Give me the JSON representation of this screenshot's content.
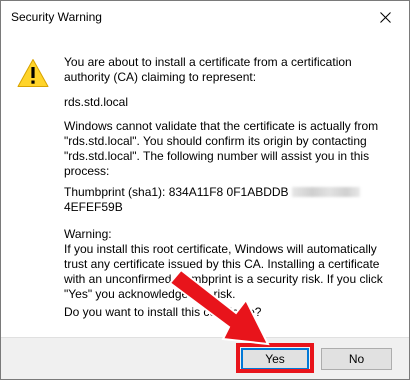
{
  "window": {
    "title": "Security Warning",
    "close_icon": "close-icon"
  },
  "message": {
    "intro": "You are about to install a certificate from a certification authority (CA) claiming to represent:",
    "host": "rds.std.local",
    "validation": "Windows cannot validate that the certificate is actually from \"rds.std.local\". You should confirm its origin by contacting \"rds.std.local\". The following number will assist you in this process:",
    "thumbprint_label": "Thumbprint (sha1): 834A11F8 0F1ABDDB",
    "thumbprint_end": "4EFEF59B",
    "warning_title": "Warning:",
    "warning_text": "If you install this root certificate, Windows will automatically trust any certificate issued by this CA. Installing a certificate with an unconfirmed thumbprint is a security risk. If you click \"Yes\" you acknowledge this risk.",
    "question": "Do you want to install this certificate?"
  },
  "buttons": {
    "yes": "Yes",
    "no": "No"
  },
  "colors": {
    "warning_icon_fill": "#ffd42a",
    "annotation_red": "#e8141b",
    "default_button_border": "#0078d7"
  }
}
